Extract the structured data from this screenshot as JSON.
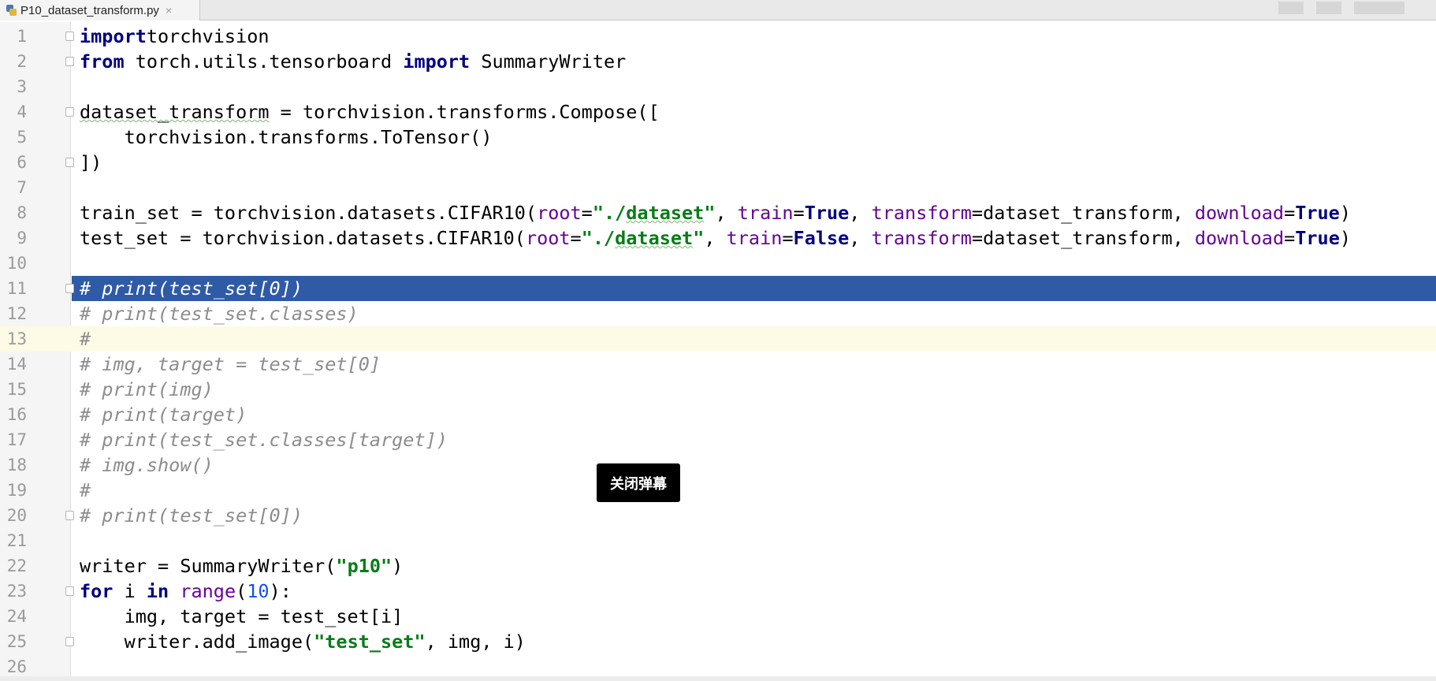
{
  "tab": {
    "filename": "P10_dataset_transform.py",
    "close": "×"
  },
  "toast": {
    "label": "关闭弹幕"
  },
  "editor": {
    "lines": [
      {
        "n": "1",
        "segs": [
          [
            "kw",
            "import"
          ],
          [
            "",
            "torchvision"
          ]
        ],
        "fold": true
      },
      {
        "n": "2",
        "segs": [
          [
            "kw",
            "from"
          ],
          [
            "",
            " torch.utils.tensorboard "
          ],
          [
            "kw",
            "import"
          ],
          [
            "",
            " SummaryWriter"
          ]
        ],
        "fold": true
      },
      {
        "n": "3",
        "segs": []
      },
      {
        "n": "4",
        "segs": [
          [
            "squig",
            "dataset_transform"
          ],
          [
            "",
            " = torchvision.transforms.Compose(["
          ]
        ],
        "fold": true
      },
      {
        "n": "5",
        "segs": [
          [
            "",
            "    torchvision.transforms.ToTensor()"
          ]
        ]
      },
      {
        "n": "6",
        "segs": [
          [
            "",
            "])"
          ]
        ],
        "fold": true
      },
      {
        "n": "7",
        "segs": []
      },
      {
        "n": "8",
        "segs": [
          [
            "",
            "train_set = torchvision.datasets.CIFAR10("
          ],
          [
            "param",
            "root"
          ],
          [
            "",
            "="
          ],
          [
            "str",
            "\"./"
          ],
          [
            "str squig",
            "dataset"
          ],
          [
            "str",
            "\""
          ],
          [
            "",
            ", "
          ],
          [
            "param",
            "train"
          ],
          [
            "",
            "="
          ],
          [
            "kw",
            "True"
          ],
          [
            "",
            ", "
          ],
          [
            "param",
            "transform"
          ],
          [
            "",
            "=dataset_transform, "
          ],
          [
            "param",
            "download"
          ],
          [
            "",
            "="
          ],
          [
            "kw",
            "True"
          ],
          [
            "",
            ")"
          ]
        ]
      },
      {
        "n": "9",
        "segs": [
          [
            "",
            "test_set = torchvision.datasets.CIFAR10("
          ],
          [
            "param",
            "root"
          ],
          [
            "",
            "="
          ],
          [
            "str",
            "\"./"
          ],
          [
            "str squig",
            "dataset"
          ],
          [
            "str",
            "\""
          ],
          [
            "",
            ", "
          ],
          [
            "param",
            "train"
          ],
          [
            "",
            "="
          ],
          [
            "kw",
            "False"
          ],
          [
            "",
            ", "
          ],
          [
            "param",
            "transform"
          ],
          [
            "",
            "=dataset_transform, "
          ],
          [
            "param",
            "download"
          ],
          [
            "",
            "="
          ],
          [
            "kw",
            "True"
          ],
          [
            "",
            ")"
          ]
        ]
      },
      {
        "n": "10",
        "segs": []
      },
      {
        "n": "11",
        "segs": [
          [
            "cm",
            "# print(test_set[0])"
          ]
        ],
        "selected": true,
        "fold": true
      },
      {
        "n": "12",
        "segs": [
          [
            "cm",
            "# print(test_set.classes)"
          ]
        ]
      },
      {
        "n": "13",
        "segs": [
          [
            "cm",
            "#"
          ]
        ],
        "current": true
      },
      {
        "n": "14",
        "segs": [
          [
            "cm",
            "# img, target = test_set[0]"
          ]
        ]
      },
      {
        "n": "15",
        "segs": [
          [
            "cm",
            "# print(img)"
          ]
        ]
      },
      {
        "n": "16",
        "segs": [
          [
            "cm",
            "# print(target)"
          ]
        ]
      },
      {
        "n": "17",
        "segs": [
          [
            "cm",
            "# print(test_set.classes[target])"
          ]
        ]
      },
      {
        "n": "18",
        "segs": [
          [
            "cm",
            "# img.show()"
          ]
        ]
      },
      {
        "n": "19",
        "segs": [
          [
            "cm",
            "#"
          ]
        ]
      },
      {
        "n": "20",
        "segs": [
          [
            "cm",
            "# print(test_set[0])"
          ]
        ],
        "fold": true
      },
      {
        "n": "21",
        "segs": []
      },
      {
        "n": "22",
        "segs": [
          [
            "",
            "writer = SummaryWriter("
          ],
          [
            "str",
            "\"p10\""
          ],
          [
            "",
            ")"
          ]
        ]
      },
      {
        "n": "23",
        "segs": [
          [
            "kw",
            "for"
          ],
          [
            "",
            " i "
          ],
          [
            "kw",
            "in"
          ],
          [
            "",
            " "
          ],
          [
            "param",
            "range"
          ],
          [
            "",
            "("
          ],
          [
            "num",
            "10"
          ],
          [
            "",
            "):"
          ]
        ],
        "fold": true
      },
      {
        "n": "24",
        "segs": [
          [
            "",
            "    img, target = test_set[i]"
          ]
        ]
      },
      {
        "n": "25",
        "segs": [
          [
            "",
            "    writer.add_image("
          ],
          [
            "str",
            "\"test_set\""
          ],
          [
            "",
            ", img, i)"
          ]
        ],
        "fold": true
      },
      {
        "n": "26",
        "segs": []
      }
    ]
  },
  "colors": {
    "keyword": "#000080",
    "string": "#067d17",
    "number": "#1750eb",
    "param": "#660099",
    "comment": "#8c8c8c",
    "selection": "#2f5aa6",
    "current_line": "#fdfbe5"
  },
  "icons": {
    "tab_file_icon": "python-file-icon"
  }
}
